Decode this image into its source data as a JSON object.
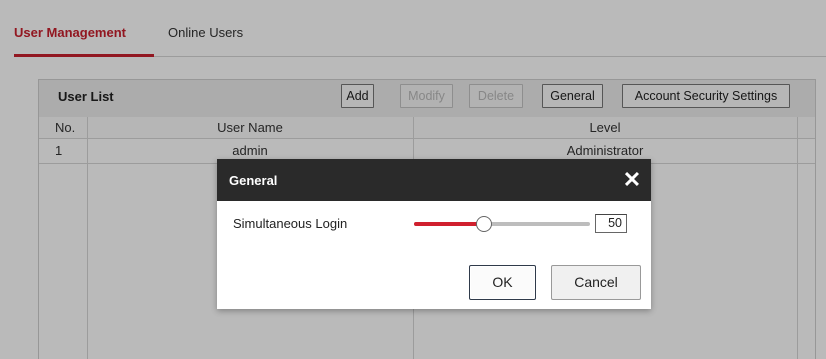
{
  "tabs": [
    {
      "label": "User Management",
      "active": true
    },
    {
      "label": "Online Users",
      "active": false
    }
  ],
  "user_list": {
    "title": "User List",
    "buttons": {
      "add": "Add",
      "modify": "Modify",
      "delete": "Delete",
      "general": "General",
      "security": "Account Security Settings"
    },
    "columns": [
      "No.",
      "User Name",
      "Level"
    ],
    "rows": [
      {
        "no": "1",
        "name": "admin",
        "level": "Administrator"
      }
    ]
  },
  "dialog": {
    "title": "General",
    "close_icon": "close-icon",
    "field_label": "Simultaneous Login",
    "slider_level_fraction": 0.4,
    "value": "50",
    "ok_label": "OK",
    "cancel_label": "Cancel"
  },
  "colors": {
    "accent": "#c8202e",
    "dialog_header": "#2a2a2a",
    "overlay": "rgba(0,0,0,0.27)"
  }
}
